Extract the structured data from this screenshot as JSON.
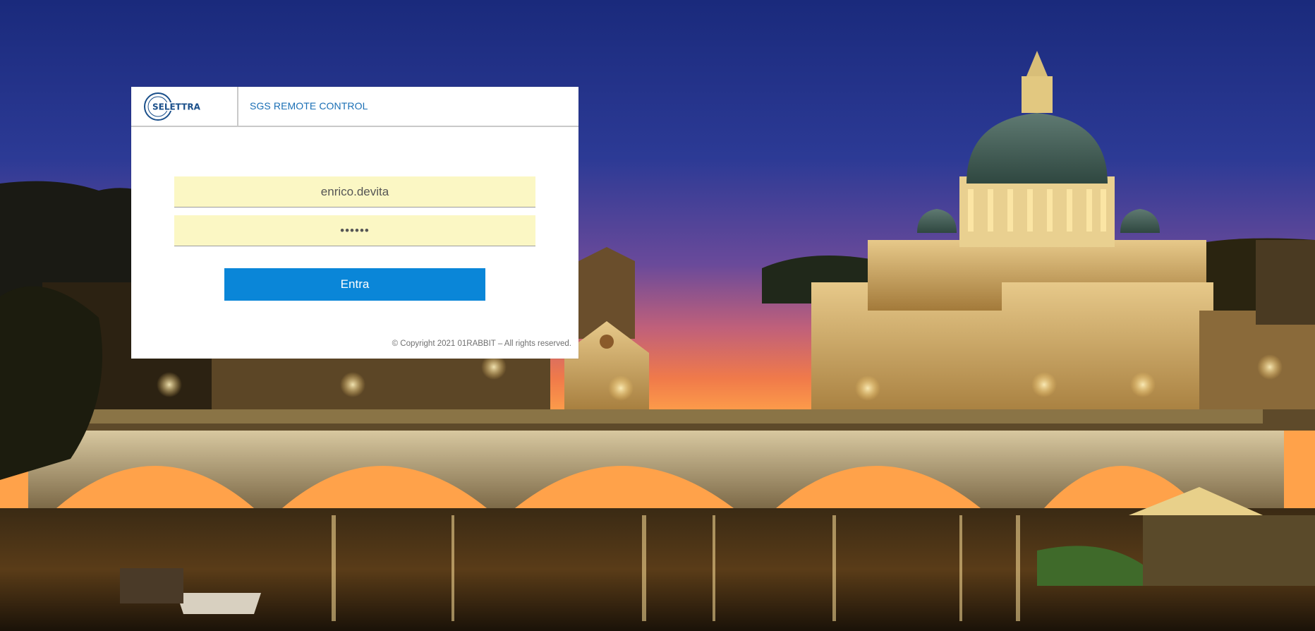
{
  "header": {
    "logo_text": "SELETTRA",
    "app_title": "SGS REMOTE CONTROL"
  },
  "form": {
    "username_value": "enrico.devita",
    "password_value": "••••••",
    "submit_label": "Entra"
  },
  "footer": {
    "copyright": "© Copyright 2021 01RABBIT – All rights reserved."
  },
  "colors": {
    "accent": "#0a86d8",
    "title": "#1a6fb5",
    "field_bg": "#fbf7c4"
  }
}
